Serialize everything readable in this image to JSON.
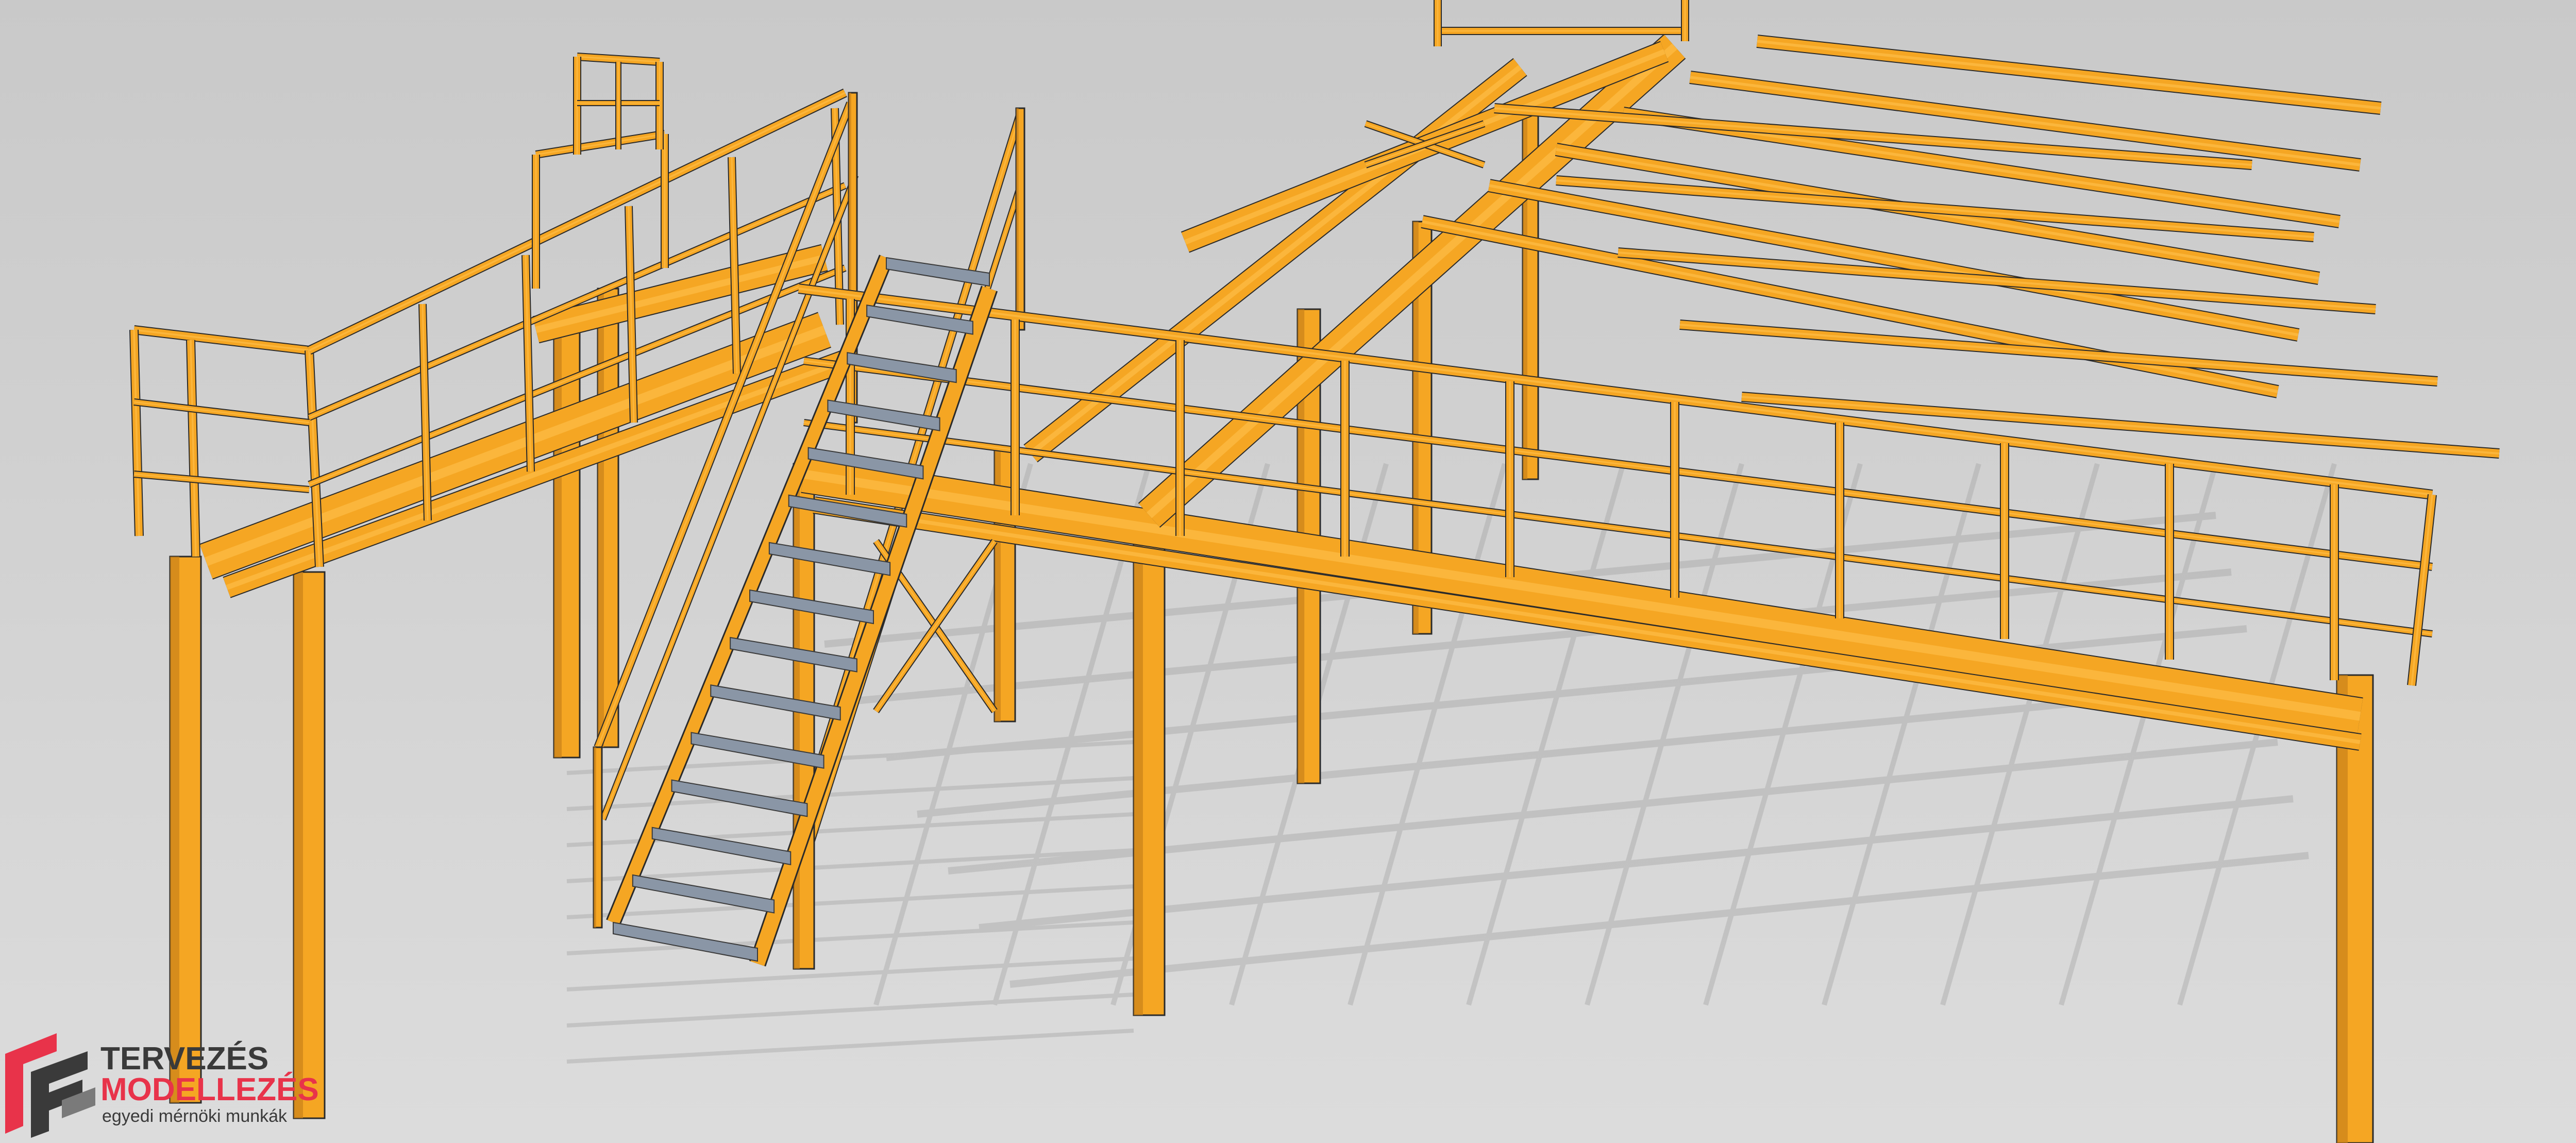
{
  "scene": {
    "background_color": "#d2d2d2",
    "steel_color": "#f5a623",
    "steel_dark_color": "#c9821a",
    "steel_light_color": "#ffc24d",
    "shadow_color": "#9b9b9b",
    "stair_tread_color": "#8a96a6",
    "subject": "yellow steel mezzanine platform with staircase and guardrails"
  },
  "logo": {
    "line1": "TERVEZÉS",
    "line2": "MODELLEZÉS",
    "line3": "egyedi mérnöki munkák",
    "icon": "logo-mark-icon",
    "line1_color": "#3a3a3a",
    "line2_color": "#e8334a",
    "line3_color": "#3a3a3a"
  }
}
